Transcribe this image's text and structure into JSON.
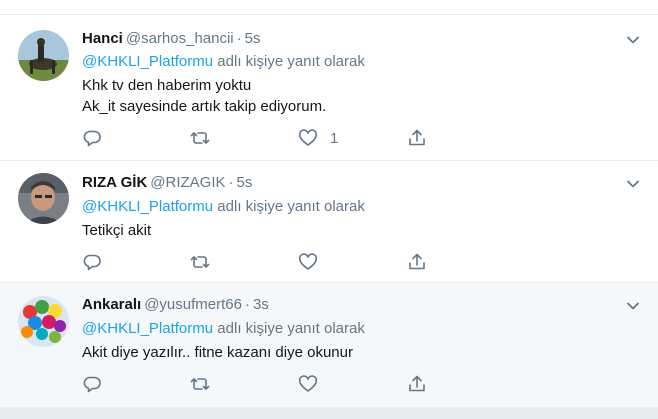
{
  "tweets": [
    {
      "name": "Hanci",
      "handle": "@sarhos_hancii",
      "dot": "·",
      "time": "5s",
      "reply_mention": "@KHKLI_Platformu",
      "reply_suffix": "adlı kişiye yanıt olarak",
      "lines": [
        "Khk tv den haberim yoktu",
        "Ak_it sayesinde artık takip ediyorum."
      ],
      "like_count": "1"
    },
    {
      "name": "RIZA GİK",
      "handle": "@RIZAGIK",
      "dot": "·",
      "time": "5s",
      "reply_mention": "@KHKLI_Platformu",
      "reply_suffix": "adlı kişiye yanıt olarak",
      "lines": [
        "Tetikçi akit"
      ],
      "like_count": ""
    },
    {
      "name": "Ankaralı",
      "handle": "@yusufmert66",
      "dot": "·",
      "time": "3s",
      "reply_mention": "@KHKLI_Platformu",
      "reply_suffix": "adlı kişiye yanıt olarak",
      "lines": [
        "Akit diye yazılır.. fitne kazanı diye okunur"
      ],
      "like_count": ""
    }
  ],
  "colors": {
    "accent": "#1da1f2",
    "secondary_text": "#657786",
    "primary_text": "#14171a",
    "divider": "#e6ecf0",
    "hover_bg": "#f5f8fa"
  },
  "icons": {
    "reply": "reply-icon",
    "retweet": "retweet-icon",
    "like": "heart-icon",
    "share": "share-icon",
    "menu": "chevron-down-icon"
  }
}
